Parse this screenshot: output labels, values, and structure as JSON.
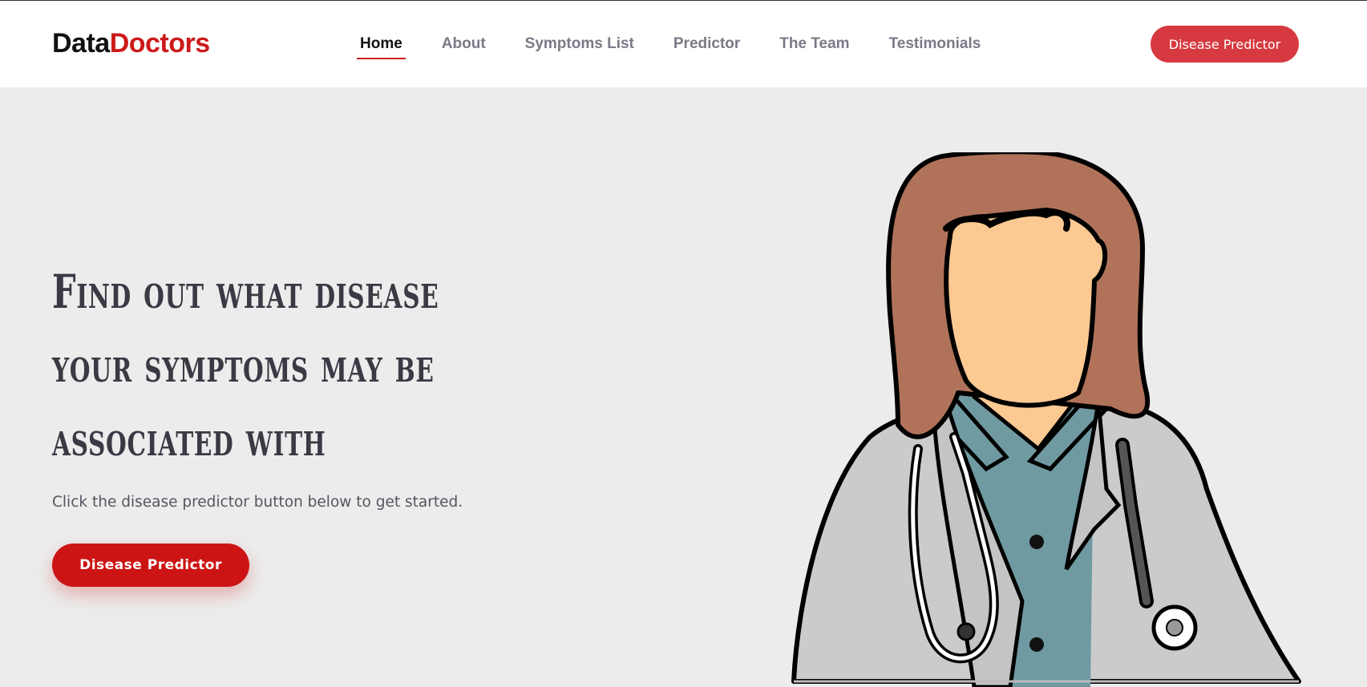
{
  "brand": {
    "part1": "Data",
    "part2": "Doctors",
    "accent": "#cc1a1a"
  },
  "nav": {
    "items": [
      {
        "label": "Home",
        "active": true
      },
      {
        "label": "About",
        "active": false
      },
      {
        "label": "Symptoms List",
        "active": false
      },
      {
        "label": "Predictor",
        "active": false
      },
      {
        "label": "The Team",
        "active": false
      },
      {
        "label": "Testimonials",
        "active": false
      }
    ]
  },
  "header_cta": {
    "label": "Disease Predictor",
    "color": "#d63a40"
  },
  "hero": {
    "title_lines": [
      "Find out what disease",
      "your symptoms may be",
      "associated with"
    ],
    "subtitle": "Click the disease predictor button below to get started.",
    "cta_label": "Disease Predictor",
    "cta_color": "#cc1414"
  },
  "illustration": {
    "icon": "doctor-illustration"
  }
}
